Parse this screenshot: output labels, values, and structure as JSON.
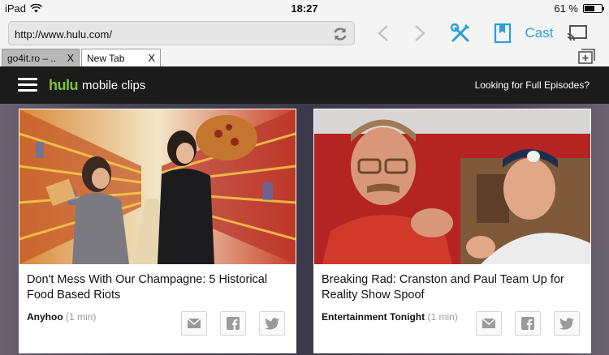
{
  "status_bar": {
    "device": "iPad",
    "time": "18:27",
    "battery_text": "61 %",
    "battery_level": 0.61
  },
  "toolbar": {
    "url": "http://www.hulu.com/",
    "cast_label": "Cast"
  },
  "tabs": [
    {
      "label": "go4it.ro – ..",
      "close": "X",
      "active": false
    },
    {
      "label": "New Tab",
      "close": "X",
      "active": true
    }
  ],
  "header": {
    "logo": "hulu",
    "logo_suffix": "mobile clips",
    "full_episodes_link": "Looking for Full Episodes?"
  },
  "cards": [
    {
      "title": "Don't Mess With Our Champagne: 5 Historical Food Based Riots",
      "source": "Anyhoo",
      "duration": "(1 min)"
    },
    {
      "title": "Breaking Rad: Cranston and Paul Team Up for Reality Show Spoof",
      "source": "Entertainment Tonight",
      "duration": "(1 min)"
    }
  ],
  "colors": {
    "accent": "#2a9fd8",
    "hulu_green": "#7ec242",
    "header_bg": "#1b1b1b"
  }
}
